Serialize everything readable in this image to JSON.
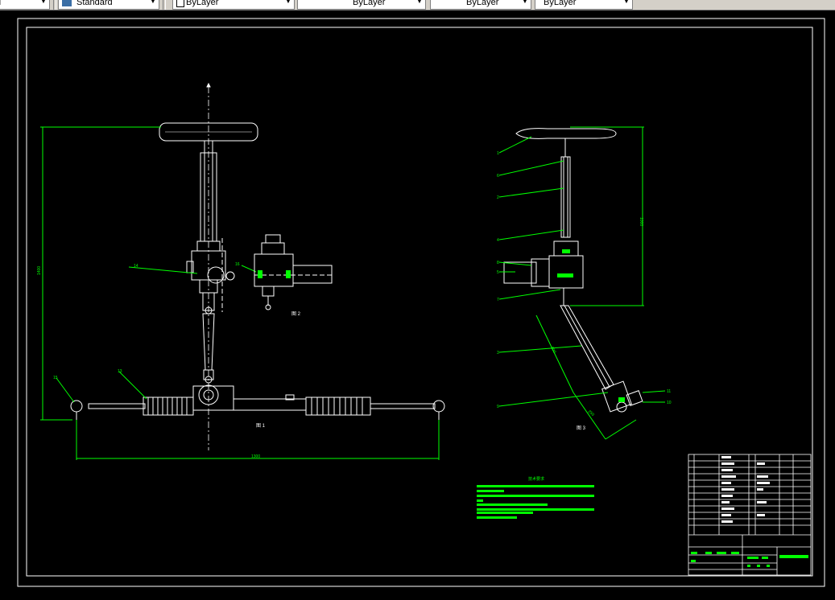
{
  "toolbar": {
    "text_style": "d",
    "dim_style": "Standard",
    "layer_color": "ByLayer",
    "linetype": "ByLayer",
    "lineweight": "ByLayer",
    "plot_style": "ByLayer"
  },
  "drawing": {
    "view_a_caption": "图 1",
    "view_b_caption": "图 2",
    "view_c_caption": "图 3",
    "overall_width_dim": "1300",
    "overall_height_dim": "1400",
    "column_height_dim": "1000",
    "shaft_dim": "600",
    "shaft_dim2": "250",
    "part_labels_left": [
      "14",
      "13",
      "16",
      "15"
    ],
    "part_labels_right": [
      "1",
      "6",
      "2",
      "4",
      "8",
      "5",
      "7",
      "3",
      "9",
      "11",
      "10"
    ],
    "notes_title": "技术要求"
  },
  "colors": {
    "line": "#ffffff",
    "dim": "#00ff00",
    "background": "#000000"
  }
}
